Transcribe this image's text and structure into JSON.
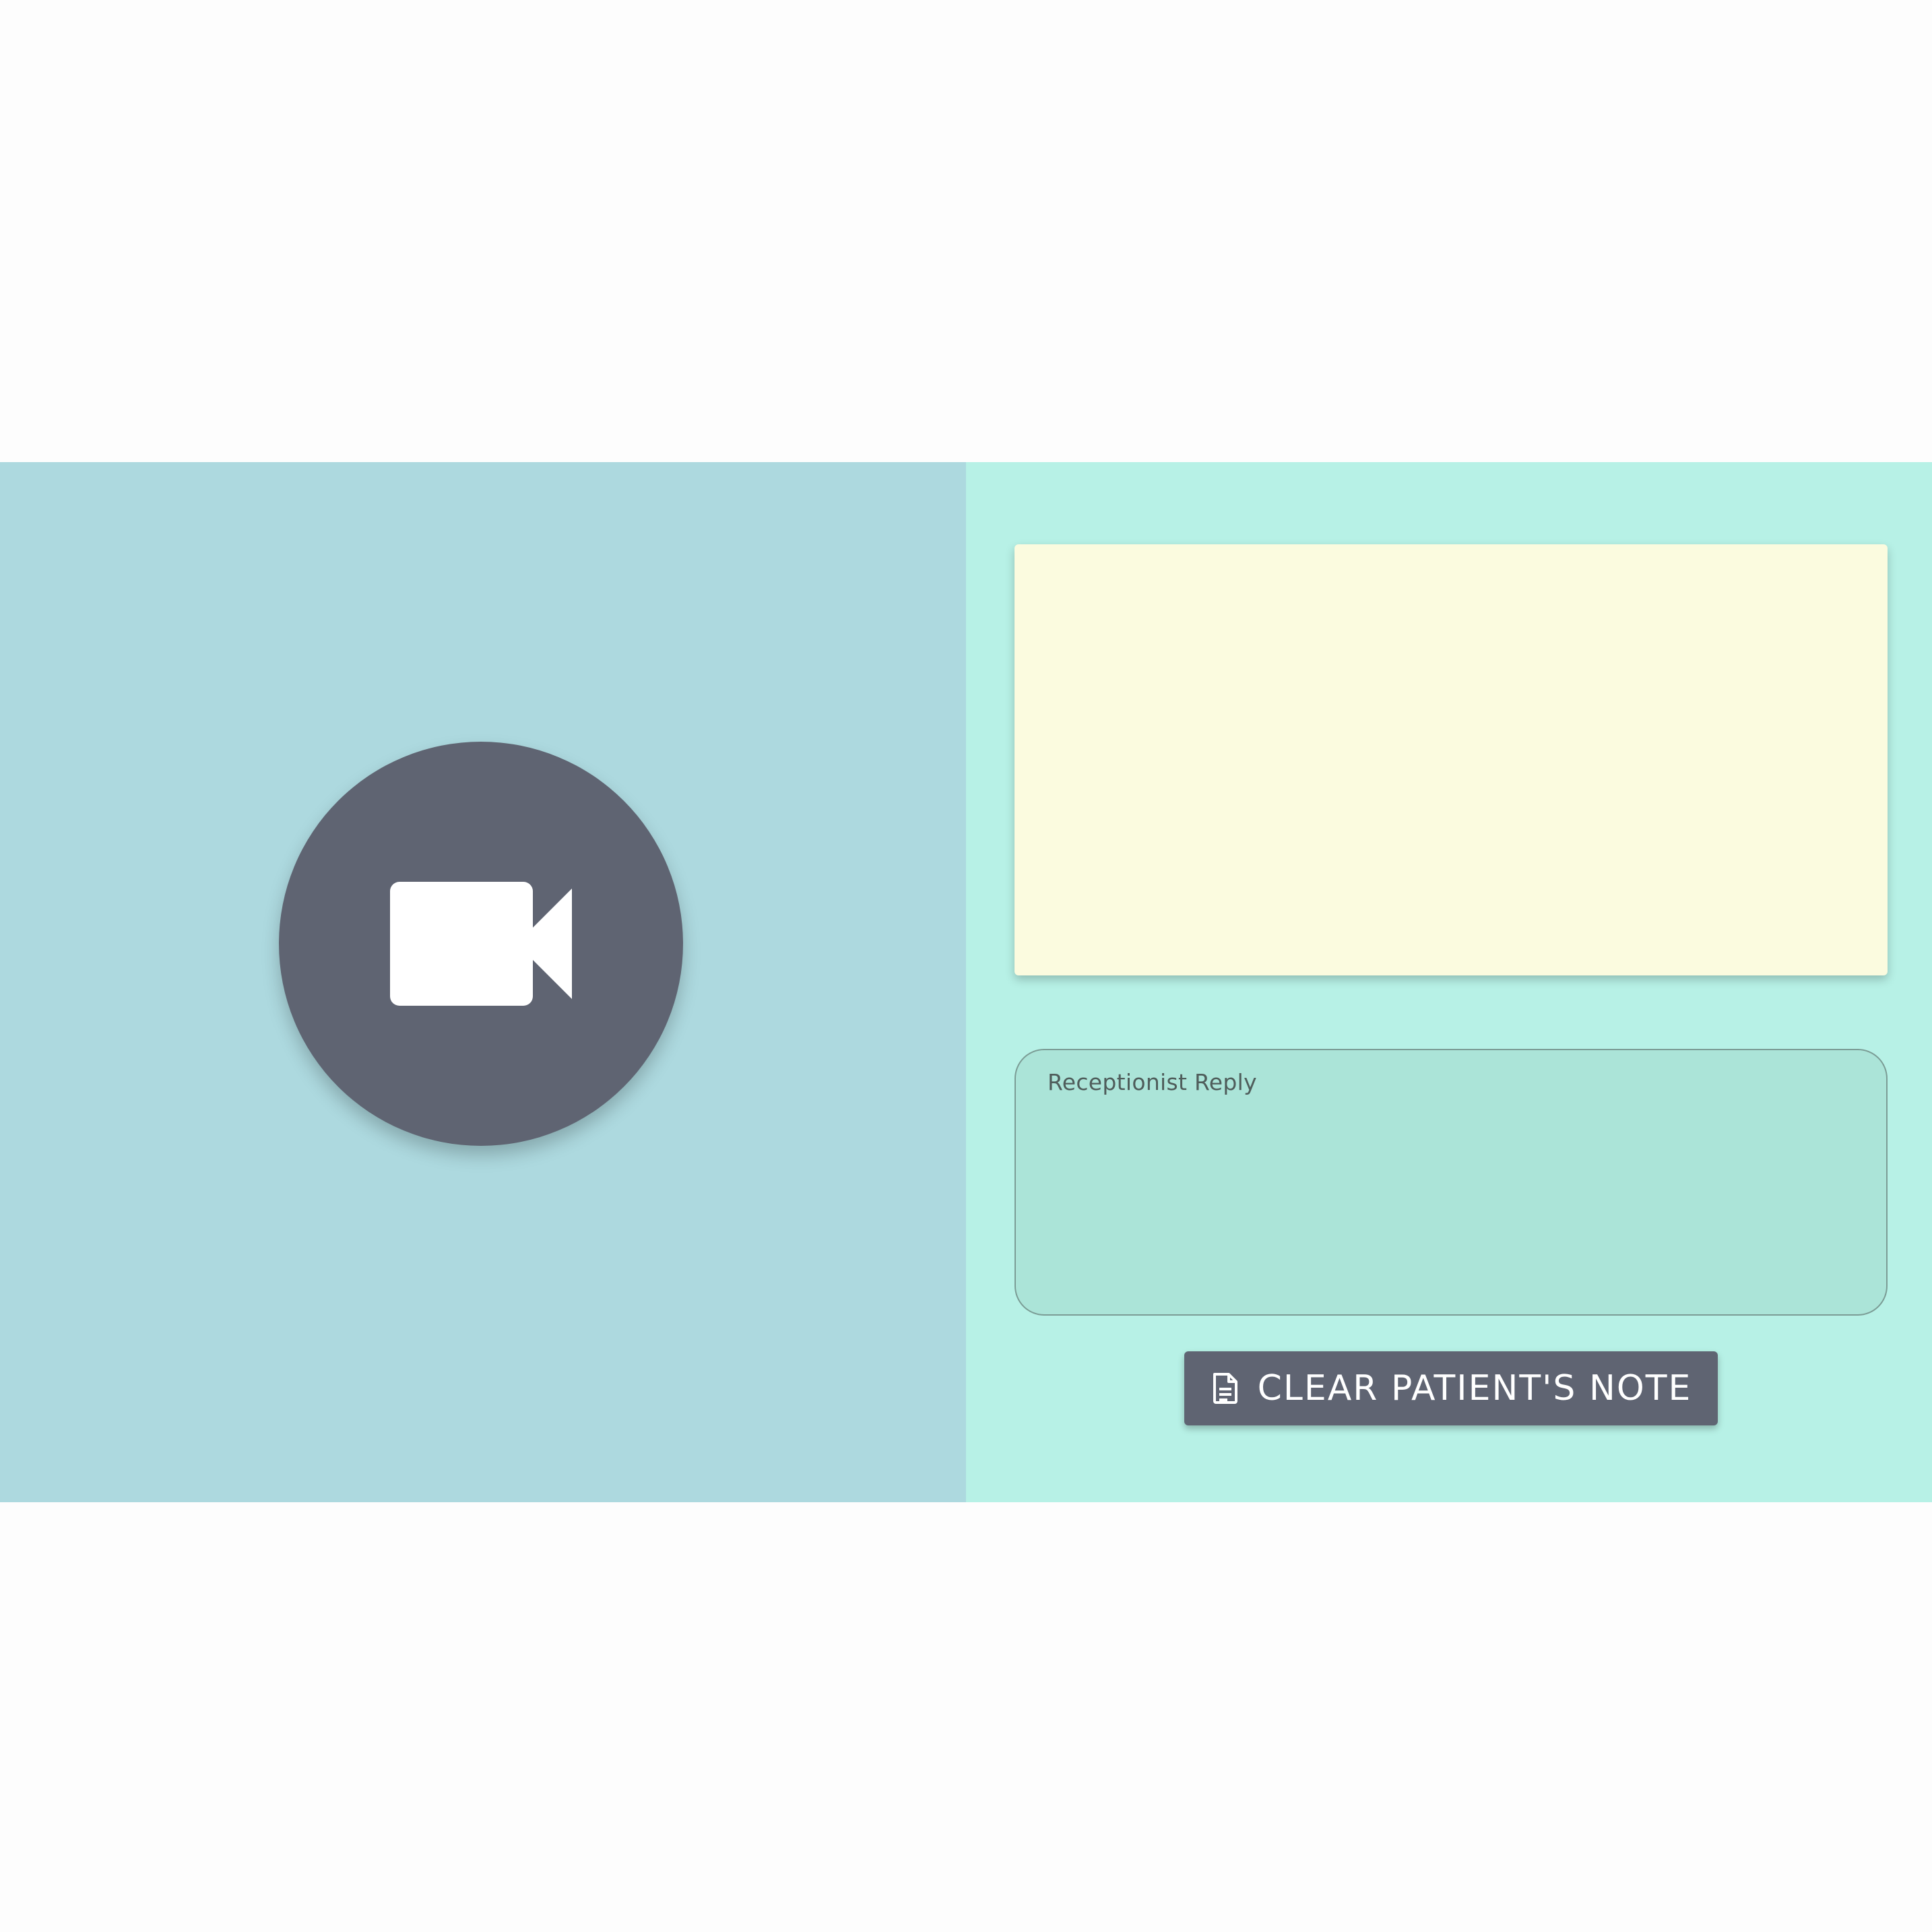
{
  "video": {
    "icon": "video-camera-icon"
  },
  "patient_note": {
    "text": ""
  },
  "reply": {
    "label": "Receptionist Reply",
    "value": ""
  },
  "clear_button": {
    "icon": "document-icon",
    "label": "CLEAR PATIENT'S NOTE"
  },
  "colors": {
    "video_pane_bg": "#add9df",
    "notes_pane_bg": "#b7f1e6",
    "note_bg": "#fbfbdf",
    "reply_bg": "#abe4d8",
    "button_bg": "#5f6472"
  }
}
